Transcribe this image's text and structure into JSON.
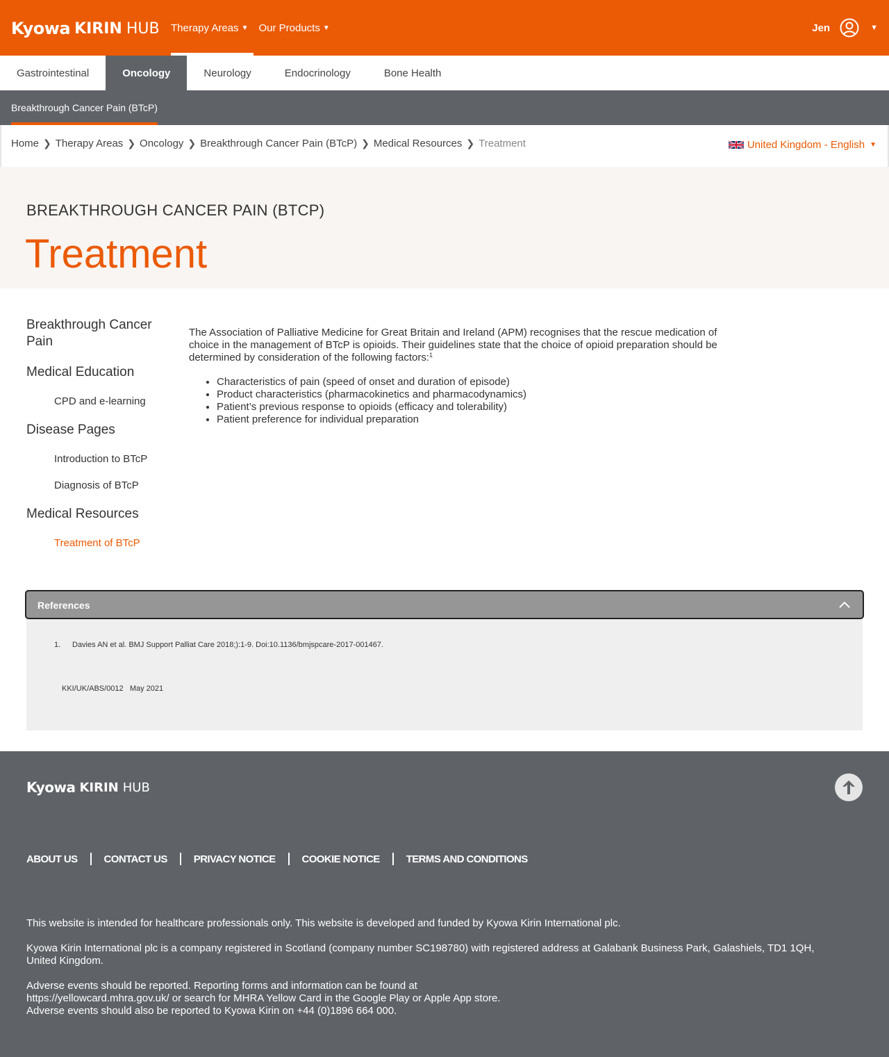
{
  "brand": {
    "logo_mark": "Kyowa",
    "logo_kirin": "KIRIN",
    "logo_hub": "HUB"
  },
  "topnav": [
    {
      "label": "Therapy Areas"
    },
    {
      "label": "Our Products"
    }
  ],
  "user": {
    "name": "Jen"
  },
  "therapy_tabs": [
    {
      "label": "Gastrointestinal"
    },
    {
      "label": "Oncology"
    },
    {
      "label": "Neurology"
    },
    {
      "label": "Endocrinology"
    },
    {
      "label": "Bone Health"
    }
  ],
  "subnav": {
    "label": "Breakthrough Cancer Pain (BTcP)"
  },
  "breadcrumb": [
    {
      "label": "Home"
    },
    {
      "label": "Therapy Areas"
    },
    {
      "label": "Oncology"
    },
    {
      "label": "Breakthrough Cancer Pain (BTcP)"
    },
    {
      "label": "Medical Resources"
    },
    {
      "label": "Treatment"
    }
  ],
  "locale": {
    "label": "United Kingdom - English"
  },
  "hero": {
    "eyebrow": "BREAKTHROUGH CANCER PAIN (BTCP)",
    "title": "Treatment"
  },
  "sidenav": {
    "h1": "Breakthrough Cancer Pain",
    "h2": "Medical Education",
    "h2_sub1": "CPD and e-learning",
    "h3": "Disease Pages",
    "h3_sub1": "Introduction to BTcP",
    "h3_sub2": "Diagnosis of BTcP",
    "h4": "Medical Resources",
    "h4_sub1": "Treatment of BTcP"
  },
  "content": {
    "intro": "The Association of Palliative Medicine for Great Britain and Ireland (APM) recognises that the rescue medication of choice in the management of BTcP is opioids. Their guidelines state that the choice of opioid preparation should be determined by consideration of the following factors:",
    "intro_sup": "1",
    "bullets": [
      "Characteristics of pain (speed of onset and duration of episode)",
      "Product characteristics (pharmacokinetics and pharmacodynamics)",
      "Patient’s previous response to opioids (efficacy and tolerability)",
      "Patient preference for individual preparation"
    ]
  },
  "references": {
    "title": "References",
    "items": [
      {
        "num": "1.",
        "text": "Davies AN et al. BMJ Support Palliat Care 2018;):1-9. Doi:10.1136/bmjspcare-2017-001467."
      }
    ],
    "code": "KKI/UK/ABS/0012   May 2021"
  },
  "footer": {
    "links": [
      {
        "label": "ABOUT US"
      },
      {
        "label": "CONTACT US"
      },
      {
        "label": "PRIVACY NOTICE"
      },
      {
        "label": "COOKIE NOTICE"
      },
      {
        "label": "TERMS AND CONDITIONS"
      }
    ],
    "text1": "This website is intended for healthcare professionals only. This website is developed and funded by Kyowa Kirin International plc.",
    "text2": "Kyowa Kirin International plc is a company registered in Scotland (company number SC198780) with registered address at Galabank Business Park, Galashiels, TD1 1QH, United Kingdom.",
    "text3_line1": "Adverse events should be reported. Reporting forms and information can be found at",
    "text3_line2": "https://yellowcard.mhra.gov.uk/ or search for MHRA Yellow Card in the Google Play or Apple App store.",
    "text3_line3": "Adverse events should also be reported to Kyowa Kirin on +44 (0)1896 664 000."
  },
  "colors": {
    "brand_orange": "#eb5a04",
    "dark_gray": "#5f6368",
    "hero_bg": "#f8f5f3"
  },
  "icons": {
    "user": "user-circle-icon",
    "back_to_top": "arrow-up-icon",
    "references_toggle": "chevron-up-icon",
    "flag": "uk-flag-icon"
  }
}
